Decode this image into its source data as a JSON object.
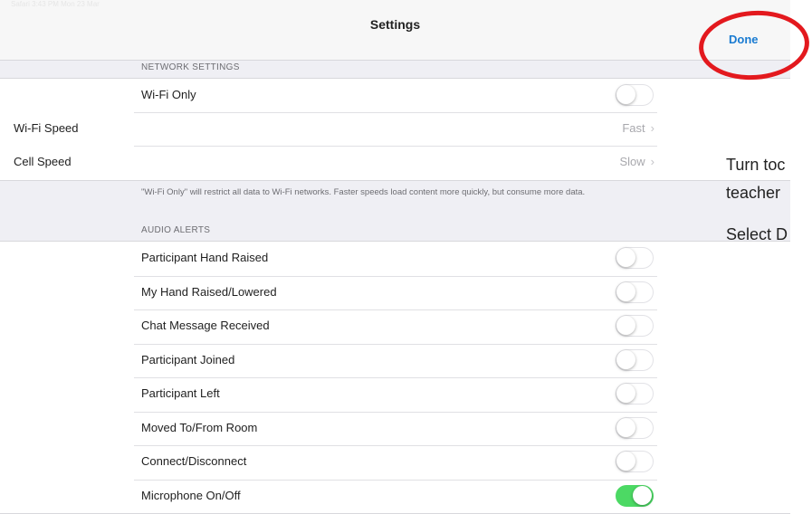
{
  "statusbar": {
    "text": "Safari  3:43 PM  Mon 23 Mar"
  },
  "navbar": {
    "title": "Settings",
    "done_label": "Done"
  },
  "network": {
    "header": "NETWORK SETTINGS",
    "wifi_only_label": "Wi-Fi Only",
    "wifi_only_on": false,
    "wifi_speed_label": "Wi-Fi Speed",
    "wifi_speed_value": "Fast",
    "cell_speed_label": "Cell Speed",
    "cell_speed_value": "Slow",
    "footer": "\"Wi-Fi Only\" will restrict all data to Wi-Fi networks. Faster speeds load content more quickly, but consume more data."
  },
  "audio": {
    "header": "AUDIO ALERTS",
    "items": [
      {
        "label": "Participant Hand Raised",
        "on": false
      },
      {
        "label": "My Hand Raised/Lowered",
        "on": false
      },
      {
        "label": "Chat Message Received",
        "on": false
      },
      {
        "label": "Participant Joined",
        "on": false
      },
      {
        "label": "Participant Left",
        "on": false
      },
      {
        "label": "Moved To/From Room",
        "on": false
      },
      {
        "label": "Connect/Disconnect",
        "on": false
      },
      {
        "label": "Microphone On/Off",
        "on": true
      }
    ]
  },
  "instructions": {
    "line1": "Turn toc",
    "line2": "teacher",
    "line3": "Select D"
  },
  "colors": {
    "accent": "#1a7bd1",
    "toggle_on": "#4cd964",
    "annotation": "#e3191e"
  }
}
